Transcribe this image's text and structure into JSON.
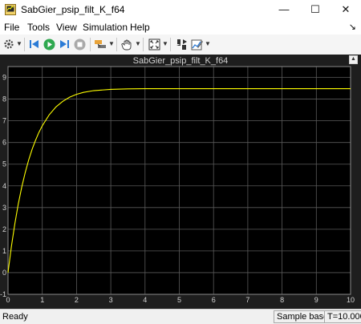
{
  "window": {
    "title": "SabGier_psip_filt_K_f64",
    "minimize_glyph": "—",
    "maximize_glyph": "☐",
    "close_glyph": "✕"
  },
  "menu": {
    "items": [
      "File",
      "Tools",
      "View",
      "Simulation",
      "Help"
    ],
    "pin_glyph": "↘"
  },
  "toolbar": {
    "icons": [
      "settings-icon",
      "step-back-icon",
      "run-icon",
      "step-forward-icon",
      "stop-icon",
      "highlight-icon",
      "pan-icon",
      "zoom-fit-icon",
      "cursor-measure-icon",
      "style-icon"
    ]
  },
  "colors": {
    "plot_background": "#000000",
    "figure_background": "#1e1e1e",
    "grid": "#5a5a5a",
    "axis_text": "#d4d4d4",
    "signal": "#ffff00"
  },
  "chart_data": {
    "type": "line",
    "title": "SabGier_psip_filt_K_f64",
    "xlim": [
      0,
      10
    ],
    "ylim": [
      -1,
      9.5
    ],
    "xticks": [
      "0",
      "1",
      "2",
      "3",
      "4",
      "5",
      "6",
      "7",
      "8",
      "9",
      "10"
    ],
    "yticks": [
      "-1",
      "0",
      "1",
      "2",
      "3",
      "4",
      "5",
      "6",
      "7",
      "8",
      "9"
    ],
    "grid": true,
    "series": [
      {
        "color": "#ffff00",
        "x": [
          0,
          0.1,
          0.2,
          0.3,
          0.4,
          0.5,
          0.6,
          0.7,
          0.8,
          0.9,
          1.0,
          1.2,
          1.4,
          1.6,
          1.8,
          2.0,
          2.2,
          2.5,
          3.0,
          3.5,
          4.0,
          4.5,
          5.0,
          6.0,
          7.0,
          8.0,
          9.0,
          10.0
        ],
        "y": [
          0,
          1.22,
          2.26,
          3.17,
          3.94,
          4.6,
          5.18,
          5.67,
          6.09,
          6.46,
          6.77,
          7.27,
          7.64,
          7.9,
          8.09,
          8.22,
          8.31,
          8.39,
          8.45,
          8.47,
          8.48,
          8.48,
          8.48,
          8.48,
          8.48,
          8.48,
          8.48,
          8.48
        ]
      }
    ]
  },
  "status": {
    "left": "Ready",
    "sample_mode": "Sample based",
    "time": "T=10.000"
  }
}
